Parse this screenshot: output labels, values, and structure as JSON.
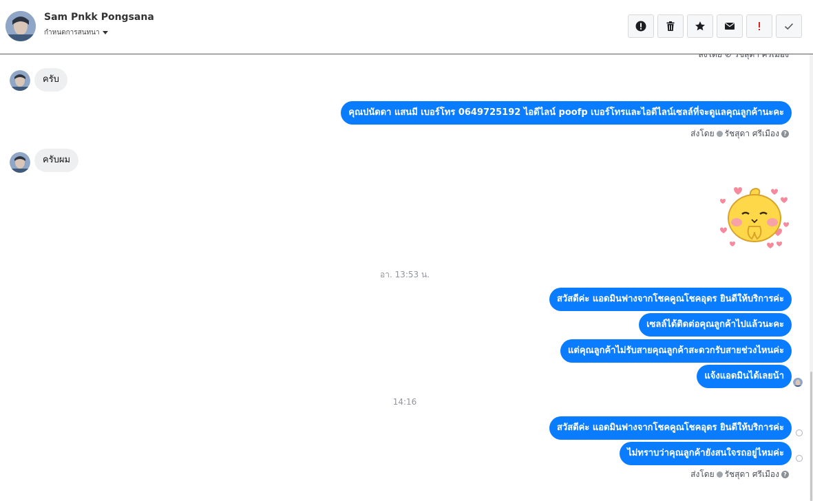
{
  "header": {
    "contact_name": "Sam Pnkk Pongsana",
    "subtitle": "กำหนดการสนทนา",
    "toolbar": [
      {
        "name": "report-spam-button",
        "icon": "exclamation-circle-icon"
      },
      {
        "name": "delete-button",
        "icon": "trash-icon"
      },
      {
        "name": "star-button",
        "icon": "star-icon"
      },
      {
        "name": "mark-unread-button",
        "icon": "envelope-icon"
      },
      {
        "name": "important-button",
        "icon": "exclamation-icon"
      },
      {
        "name": "done-button",
        "icon": "check-icon"
      }
    ]
  },
  "chat": {
    "top_partial_sentby": "ส่งโดย ⊘ รัชสุดา ศรีเมือง",
    "messages": {
      "in1": "ครับ",
      "out1": "คุณปนัดดา แสนมี   เบอร์โทร 0649725192  ไอดีไลน์ poofp   เบอร์โทรและไอดีไลน์เซลล์ที่จะดูแลคุณลูกค้านะคะ",
      "in2": "ครับผม",
      "out2": "สวัสดีค่ะ แอดมินฟางจากโชคคูณโชคอุดร ยินดีให้บริการค่ะ",
      "out3": "เซลล์ได้ติดต่อคุณลูกค้าไปแล้วนะคะ",
      "out4": "แต่คุณลูกค้าไม่รับสายคุณลูกค้าสะดวกรับสายช่วงไหนค่ะ",
      "out5": "แจ้งแอดมินได้เลยน้า",
      "out6": "สวัสดีค่ะ แอดมินฟางจากโชคคูณโชคอุดร ยินดีให้บริการค่ะ",
      "out7": "ไม่ทราบว่าคุณลูกค้ายังสนใจรถอยู่ไหมค่ะ"
    },
    "sentby_label": "ส่งโดย",
    "sentby_name": "รัชสุดา ศรีเมือง",
    "timestamp1": "อา. 13:53 น.",
    "timestamp2": "14:16"
  },
  "colors": {
    "outgoing_bubble": "#0a7cff",
    "incoming_bubble": "#eeeff1",
    "important_red": "#e02020"
  }
}
